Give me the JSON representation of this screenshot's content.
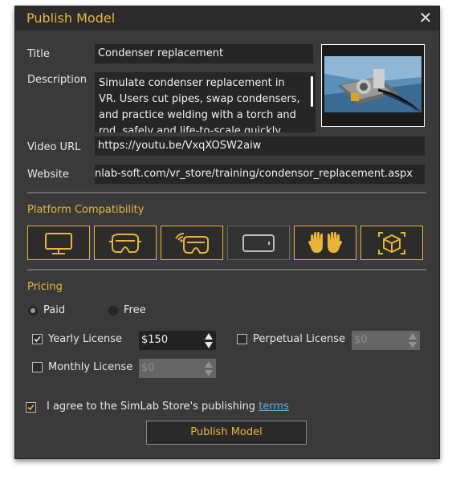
{
  "dialog": {
    "title": "Publish Model",
    "close_icon": "close-icon"
  },
  "form": {
    "title_label": "Title",
    "title_value": "Condenser replacement",
    "description_label": "Description",
    "description_value": "Simulate condenser replacement in VR. Users cut pipes, swap condensers, and practice welding with a torch and rod, safely and life-to-scale quickly...",
    "video_url_label": "Video URL",
    "video_url_value": "https://youtu.be/VxqXOSW2aiw",
    "website_label": "Website",
    "website_value": "nlab-soft.com/vr_store/training/condensor_replacement.aspx"
  },
  "platform": {
    "heading": "Platform Compatibility",
    "items": [
      {
        "icon": "desktop-monitor-icon",
        "selected": true
      },
      {
        "icon": "vr-headset-icon",
        "selected": true
      },
      {
        "icon": "wireless-vr-headset-icon",
        "selected": true
      },
      {
        "icon": "tablet-icon",
        "selected": false
      },
      {
        "icon": "hand-tracking-icon",
        "selected": true
      },
      {
        "icon": "ar-cube-icon",
        "selected": true
      }
    ]
  },
  "pricing": {
    "heading": "Pricing",
    "paid_label": "Paid",
    "free_label": "Free",
    "paid_selected": true,
    "yearly_label": "Yearly License",
    "yearly_checked": true,
    "yearly_value": "$150",
    "perpetual_label": "Perpetual License",
    "perpetual_checked": false,
    "perpetual_value": "$0",
    "monthly_label": "Monthly License",
    "monthly_checked": false,
    "monthly_value": "$0"
  },
  "agreement": {
    "text": "I agree to the SimLab Store's publishing ",
    "link": "terms",
    "checked": true
  },
  "publish_button": "Publish Model",
  "colors": {
    "accent": "#e8b53a",
    "background": "#3a3a3a",
    "field": "#262626",
    "link": "#5fb0ea"
  }
}
